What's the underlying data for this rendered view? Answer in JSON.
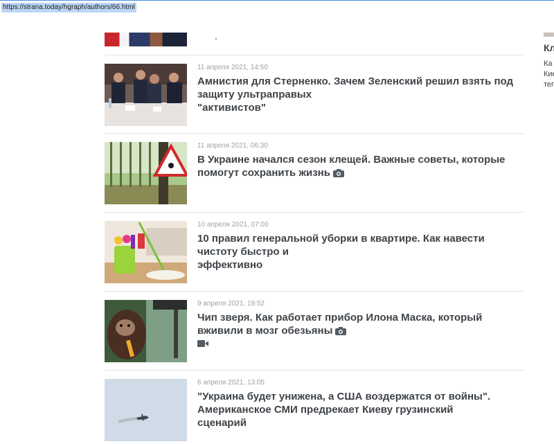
{
  "browser": {
    "url": "https://strana.today/hgraph/authors/66.html"
  },
  "top_fragment": {
    "dot": "."
  },
  "articles": [
    {
      "date": "11 апреля 2021, 14:50",
      "title_lines": [
        "Амнистия для Стерненко. Зачем Зеленский решил взять под",
        "защиту ультраправых",
        "\"активистов\""
      ],
      "has_camera": false,
      "has_video": false
    },
    {
      "date": "11 апреля 2021, 06:30",
      "title_lines": [
        "В Украине начался сезон клещей. Важные советы, которые",
        "помогут сохранить жизнь"
      ],
      "has_camera": true,
      "has_video": false
    },
    {
      "date": "10 апреля 2021, 07:00",
      "title_lines": [
        "10 правил генеральной уборки в квартире. Как навести",
        "чистоту быстро и",
        "эффективно"
      ],
      "has_camera": false,
      "has_video": false
    },
    {
      "date": "9 апреля 2021, 19:52",
      "title_lines": [
        "Чип зверя. Как работает прибор Илона Маска, который",
        "вживили в мозг обезьяны"
      ],
      "has_camera": true,
      "has_video": true
    },
    {
      "date": "6 апреля 2021, 13:05",
      "title_lines": [
        "\"Украина будет унижена, а США воздержатся от войны\".",
        "Американское СМИ предрекает Киеву грузинский",
        "сценарий"
      ],
      "has_camera": false,
      "has_video": false
    }
  ],
  "sidebar": {
    "title": "Кл",
    "lines": [
      "Ка",
      "Кие",
      "тег"
    ]
  },
  "icons": {
    "camera": "camera-icon",
    "video": "video-icon"
  },
  "colors": {
    "title": "#3e4348",
    "date": "#9aa1a8",
    "separator": "#dfe3e6",
    "url_highlight": "#bcd6f5"
  }
}
